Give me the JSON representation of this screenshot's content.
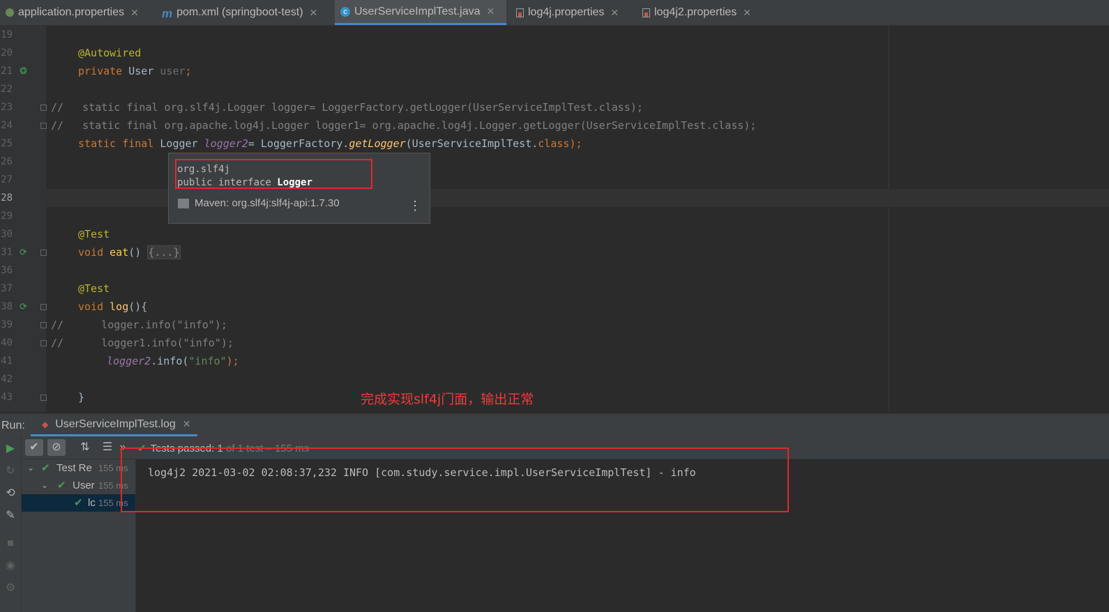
{
  "tabs": [
    {
      "label": "application.properties",
      "icon": "spring-config-icon"
    },
    {
      "label": "pom.xml (springboot-test)",
      "icon": "maven-icon"
    },
    {
      "label": "UserServiceImplTest.java",
      "icon": "java-class-icon",
      "active": true
    },
    {
      "label": "log4j.properties",
      "icon": "properties-file-icon"
    },
    {
      "label": "log4j2.properties",
      "icon": "properties-file-icon"
    }
  ],
  "editor": {
    "lines": [
      {
        "num": "19"
      },
      {
        "num": "20",
        "annotation": "@Autowired"
      },
      {
        "num": "21",
        "kw": "private",
        "type": "User",
        "field": "user",
        "end": ";"
      },
      {
        "num": "22"
      },
      {
        "num": "23",
        "comment_marker": "//",
        "code": "   static final org.slf4j.Logger logger= LoggerFactory.getLogger(UserServiceImplTest.class);"
      },
      {
        "num": "24",
        "comment_marker": "//",
        "code": "   static final org.apache.log4j.Logger logger1= org.apache.log4j.Logger.getLogger(UserServiceImplTest.class);"
      },
      {
        "num": "25",
        "kw": "static final",
        "type": "Logger",
        "field": "logger2",
        "eq": "= LoggerFactory.",
        "method": "getLogger",
        "args": "(UserServiceImplTest.",
        "kw2": "class",
        "end": ");"
      },
      {
        "num": "26"
      },
      {
        "num": "27"
      },
      {
        "num": "28"
      },
      {
        "num": "29"
      },
      {
        "num": "30",
        "annotation": "@Test"
      },
      {
        "num": "31",
        "kw": "void",
        "method": "eat",
        "paren": "() ",
        "folded": "{...}"
      },
      {
        "num": "36"
      },
      {
        "num": "37",
        "annotation": "@Test"
      },
      {
        "num": "38",
        "kw": "void",
        "method": "log",
        "paren": "(){"
      },
      {
        "num": "39",
        "comment_marker": "//",
        "code": "      logger.info(\"info\");"
      },
      {
        "num": "40",
        "comment_marker": "//",
        "code": "      logger1.info(\"info\");"
      },
      {
        "num": "41",
        "field": "logger2",
        "call": ".info(",
        "str": "\"info\"",
        "end": ");"
      },
      {
        "num": "42"
      },
      {
        "num": "43",
        "brace": "}"
      }
    ]
  },
  "tooltip": {
    "package": "org.slf4j",
    "decl_prefix": "public interface ",
    "decl_name": "Logger",
    "maven": "Maven: org.slf4j:slf4j-api:1.7.30",
    "more_icon": "more-vertical-icon"
  },
  "annotation_text": "完成实现slf4j门面，输出正常",
  "run": {
    "label": "Run:",
    "tab_label": "UserServiceImplTest.log",
    "status": {
      "text": "Tests passed: ",
      "count": "1",
      "rest": " of 1 test – 155 ms"
    },
    "tree": [
      {
        "name": "Test Re",
        "time": "155 ms",
        "level": 0,
        "expanded": true
      },
      {
        "name": "User",
        "time": "155 ms",
        "level": 1,
        "expanded": true
      },
      {
        "name": "lc",
        "time": "155 ms",
        "level": 2,
        "selected": true
      }
    ],
    "console_output": "log4j2 2021-03-02 02:08:37,232 INFO [com.study.service.impl.UserServiceImplTest] - info"
  },
  "colors": {
    "annotation_red": "#e0282e",
    "pass_green": "#499c54",
    "accent_blue": "#4a88c7"
  }
}
